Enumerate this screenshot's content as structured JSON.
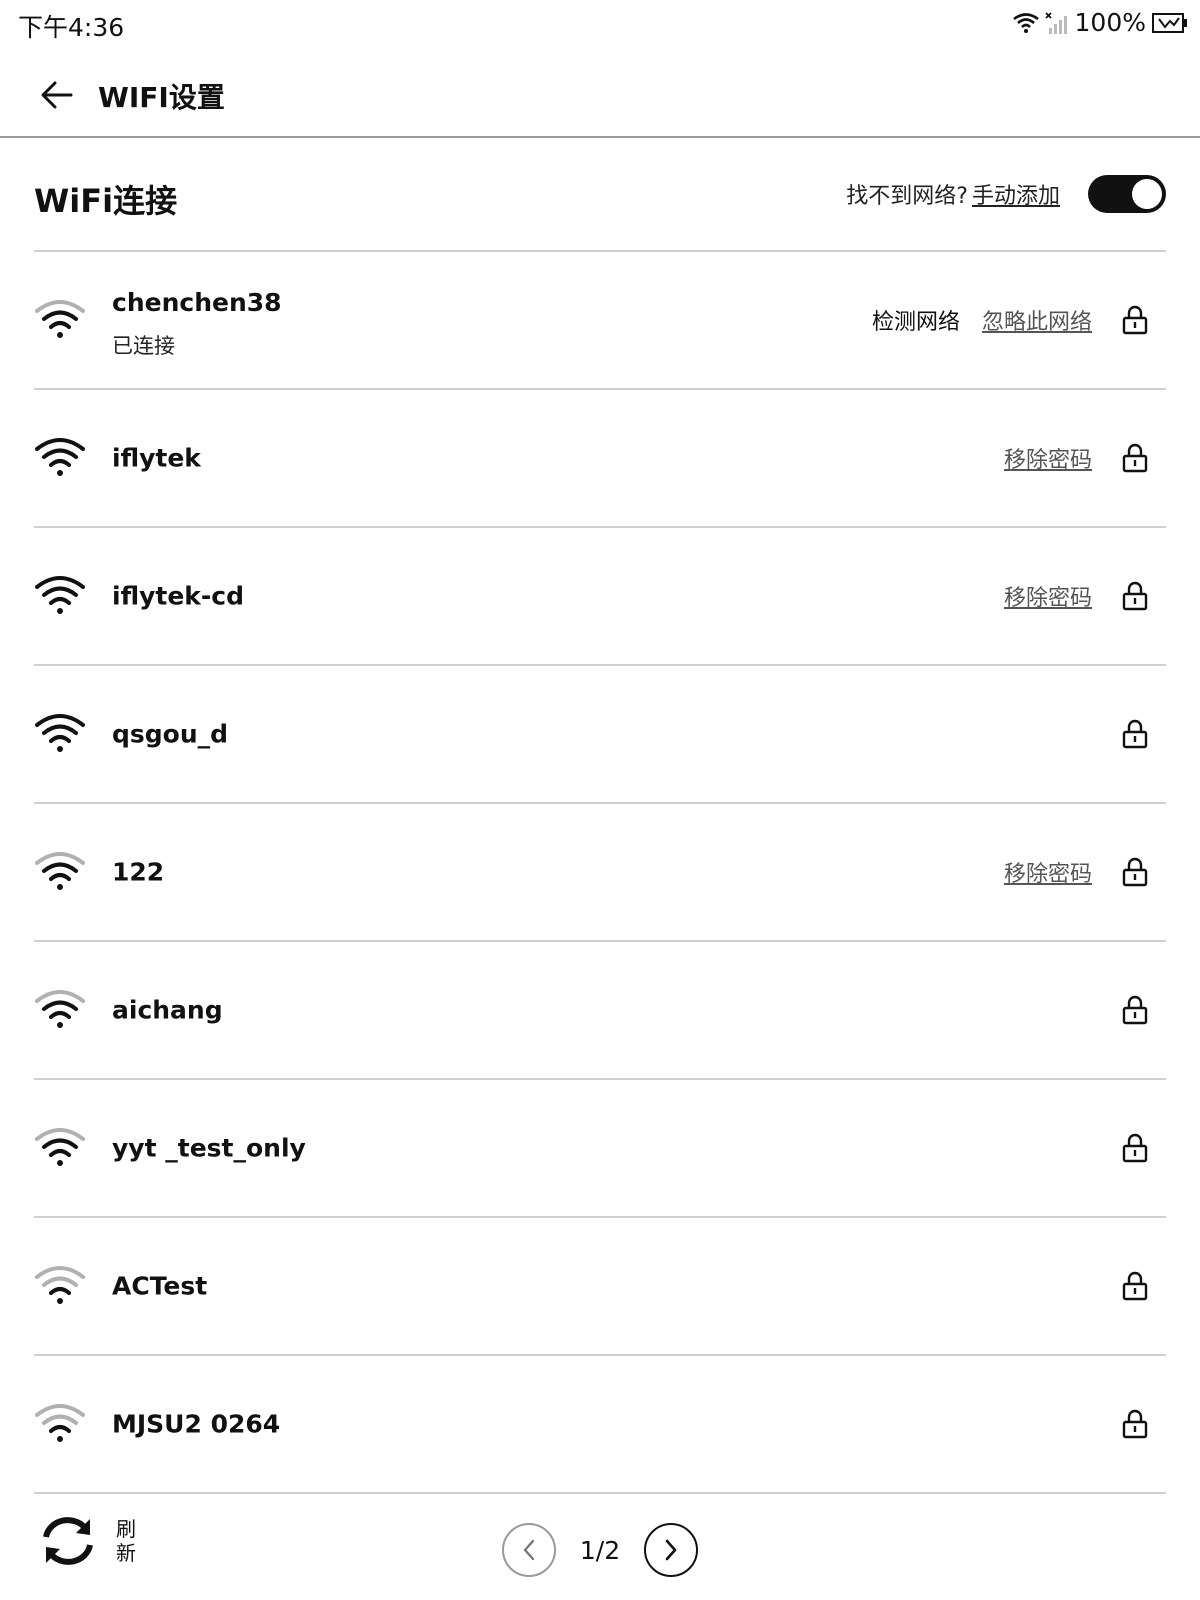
{
  "status_bar": {
    "time": "下午4:36",
    "battery": "100%",
    "icons": [
      "wifi-icon",
      "no-signal-icon",
      "battery-icon"
    ]
  },
  "header": {
    "back_icon": "arrow-left-icon",
    "title": "WIFI设置"
  },
  "section": {
    "title": "WiFi连接",
    "hint": "找不到网络?",
    "manual_add": "手动添加",
    "wifi_enabled": true
  },
  "networks": [
    {
      "name": "chenchen38",
      "status": "已连接",
      "signal": 3,
      "actions": [
        "检测网络",
        "忽略此网络"
      ],
      "locked": true
    },
    {
      "name": "iflytek",
      "status": "",
      "signal": 4,
      "actions": [
        "移除密码"
      ],
      "locked": true
    },
    {
      "name": "iflytek-cd",
      "status": "",
      "signal": 4,
      "actions": [
        "移除密码"
      ],
      "locked": true
    },
    {
      "name": "qsgou_d",
      "status": "",
      "signal": 4,
      "actions": [],
      "locked": true
    },
    {
      "name": "122",
      "status": "",
      "signal": 3,
      "actions": [
        "移除密码"
      ],
      "locked": true
    },
    {
      "name": "aichang",
      "status": "",
      "signal": 3,
      "actions": [],
      "locked": true
    },
    {
      "name": "yyt _test_only",
      "status": "",
      "signal": 3,
      "actions": [],
      "locked": true
    },
    {
      "name": "ACTest",
      "status": "",
      "signal": 2,
      "actions": [],
      "locked": true
    },
    {
      "name": "MJSU2 0264",
      "status": "",
      "signal": 2,
      "actions": [],
      "locked": true
    }
  ],
  "footer": {
    "refresh_label": "刷新",
    "page_indicator": "1/2",
    "prev_icon": "chevron-left-icon",
    "next_icon": "chevron-right-icon"
  },
  "colors": {
    "text": "#111111",
    "divider": "#cfcfcf",
    "muted_link": "#555555",
    "weak_signal": "#b0b0b0"
  }
}
